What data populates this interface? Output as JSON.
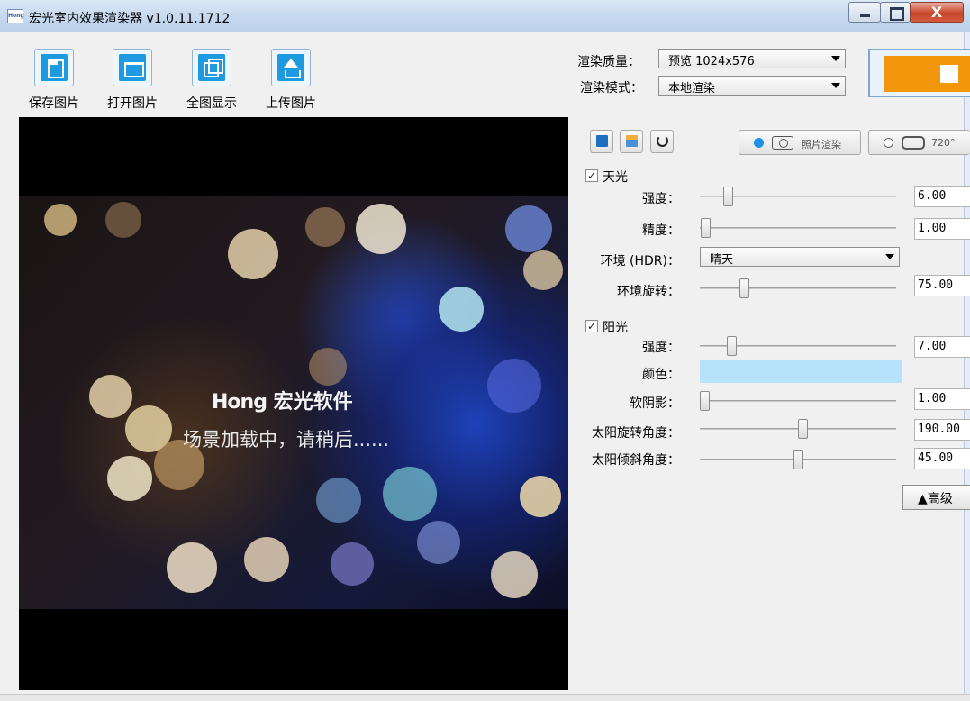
{
  "window": {
    "title": "宏光室内效果渲染器 v1.0.11.1712",
    "app_icon_text": "Hong",
    "close_glyph": "X"
  },
  "toolbar": [
    {
      "label": "保存图片",
      "icon": "save-icon"
    },
    {
      "label": "打开图片",
      "icon": "folder-open-icon"
    },
    {
      "label": "全图显示",
      "icon": "fit-view-icon"
    },
    {
      "label": "上传图片",
      "icon": "upload-icon"
    }
  ],
  "viewport": {
    "logo_en": "Hong",
    "logo_cn": "宏光软件",
    "loading_text": "场景加载中，请稍后......"
  },
  "render_settings": {
    "quality_label": "渲染质量：",
    "quality_value": "预览 1024x576",
    "mode_label": "渲染模式：",
    "mode_value": "本地渲染",
    "stop_button_color": "#f2960b"
  },
  "mode_tabs": [
    {
      "label": "照片渲染",
      "selected": true,
      "icon": "camera-icon"
    },
    {
      "label": "720°",
      "selected": false,
      "icon": "vr-goggles-icon"
    }
  ],
  "skylight": {
    "label": "天光",
    "checked": true,
    "intensity_label": "强度：",
    "intensity_value": "6.00",
    "precision_label": "精度：",
    "precision_value": "1.00",
    "env_label": "环境 (HDR)：",
    "env_value": "晴天",
    "rotation_label": "环境旋转：",
    "rotation_value": "75.00"
  },
  "sunlight": {
    "label": "阳光",
    "checked": true,
    "intensity_label": "强度：",
    "intensity_value": "7.00",
    "color_label": "颜色：",
    "color_value": "#b6e2fb",
    "soft_shadow_label": "软阴影：",
    "soft_shadow_value": "1.00",
    "sun_rotation_label": "太阳旋转角度：",
    "sun_rotation_value": "190.00",
    "sun_tilt_label": "太阳倾斜角度：",
    "sun_tilt_value": "45.00"
  },
  "advanced_button": "▲高级"
}
